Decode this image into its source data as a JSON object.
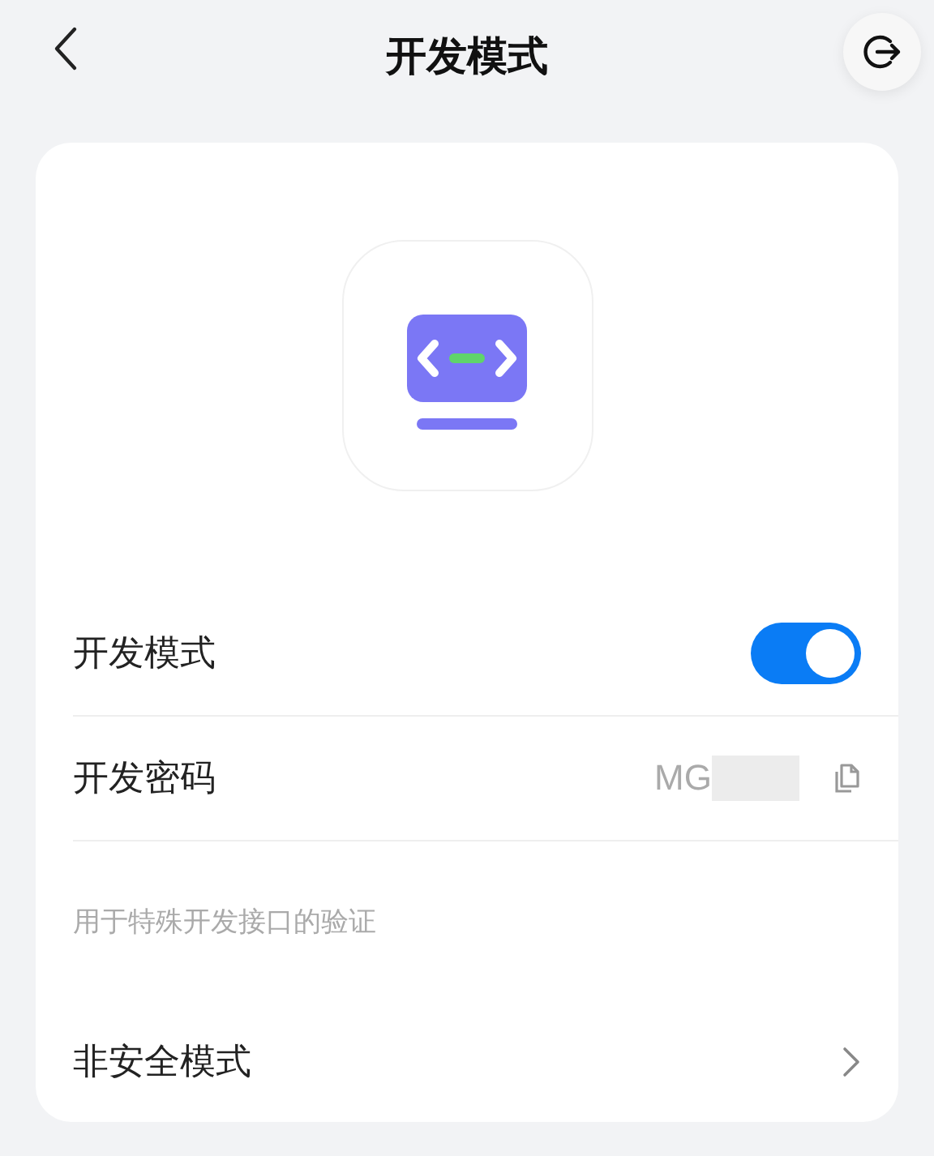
{
  "header": {
    "title": "开发模式"
  },
  "settings": [
    {
      "kind": "toggle",
      "label": "开发模式",
      "on": true
    },
    {
      "kind": "secret",
      "label": "开发密码",
      "value": "MG",
      "masked": true
    },
    {
      "kind": "hint",
      "label": "用于特殊开发接口的验证"
    },
    {
      "kind": "link",
      "label": "非安全模式"
    }
  ]
}
